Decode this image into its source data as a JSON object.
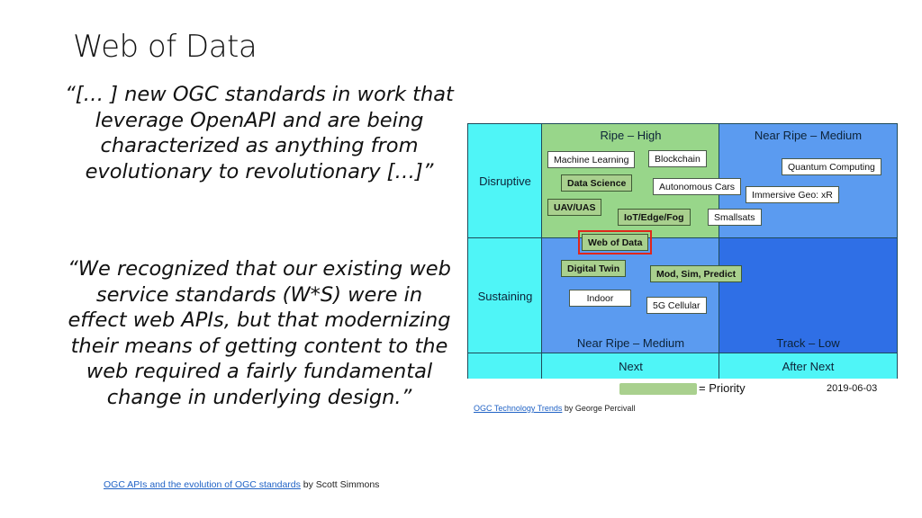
{
  "slide": {
    "title": "Web of Data",
    "quote1": "“[… ] new OGC standards in work that leverage OpenAPI and are being characterized as anything from evolutionary to revolutionary […]”",
    "quote2": "“We recognized that our existing web service standards (W*S) were in effect web APIs, but that modernizing their means of getting content to the web required a fairly fundamental change in underlying design.”",
    "credit1": {
      "link": "OGC APIs and the evolution of OGC standards",
      "suffix": " by Scott Simmons"
    },
    "credit2": {
      "link": "OGC Technology Trends",
      "suffix": " by George Percivall"
    }
  },
  "matrix": {
    "rows": [
      "Disruptive",
      "Sustaining"
    ],
    "columns_bottom": [
      "Next",
      "After Next"
    ],
    "quadrants": {
      "top_left": "Ripe – High",
      "top_right": "Near Ripe – Medium",
      "bottom_left": "Near Ripe – Medium",
      "bottom_right": "Track – Low"
    },
    "colors": {
      "axis": "#4ff5f7",
      "ripe": "#98d68a",
      "near_ripe": "#5b9bf0",
      "track": "#2f6fe6",
      "priority": "#a9d08e",
      "highlight": "#e0261b"
    },
    "items": [
      {
        "label": "Machine Learning",
        "priority": false
      },
      {
        "label": "Blockchain",
        "priority": false
      },
      {
        "label": "Data Science",
        "priority": true
      },
      {
        "label": "Autonomous Cars",
        "priority": false
      },
      {
        "label": "UAV/UAS",
        "priority": true
      },
      {
        "label": "IoT/Edge/Fog",
        "priority": true
      },
      {
        "label": "Smallsats",
        "priority": false
      },
      {
        "label": "Quantum Computing",
        "priority": false
      },
      {
        "label": "Immersive Geo: xR",
        "priority": false
      },
      {
        "label": "Web of Data",
        "priority": true,
        "highlighted": true
      },
      {
        "label": "Digital Twin",
        "priority": true
      },
      {
        "label": "Mod, Sim, Predict",
        "priority": true
      },
      {
        "label": "Indoor",
        "priority": false
      },
      {
        "label": "5G Cellular",
        "priority": false
      }
    ],
    "legend": {
      "label": "= Priority",
      "date": "2019-06-03"
    }
  }
}
